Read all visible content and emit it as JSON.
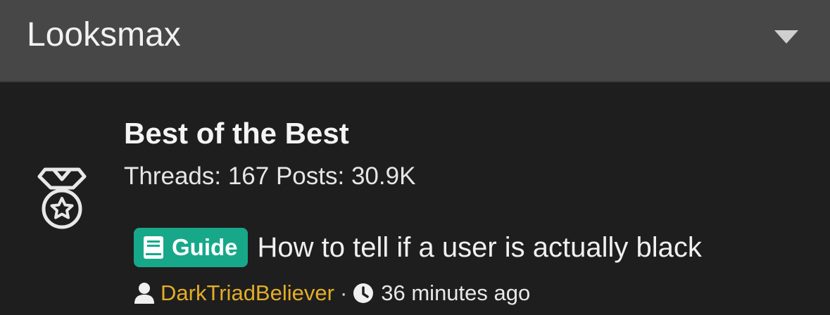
{
  "header": {
    "title": "Looksmax",
    "toggle_icon": "caret-down-icon"
  },
  "forum": {
    "icon": "medal-star-icon",
    "title": "Best of the Best",
    "stats": "Threads: 167 Posts: 30.9K"
  },
  "latest_thread": {
    "prefix": {
      "icon": "book-icon",
      "label": "Guide",
      "color": "#17a88a"
    },
    "title": "How to tell if a user is actually black",
    "author_icon": "user-icon",
    "author": "DarkTriadBeliever",
    "separator": "·",
    "time_icon": "clock-icon",
    "time": "36 minutes ago"
  },
  "colors": {
    "header_bg": "#474747",
    "body_bg": "#1e1e1e",
    "author": "#e3ad2a"
  }
}
